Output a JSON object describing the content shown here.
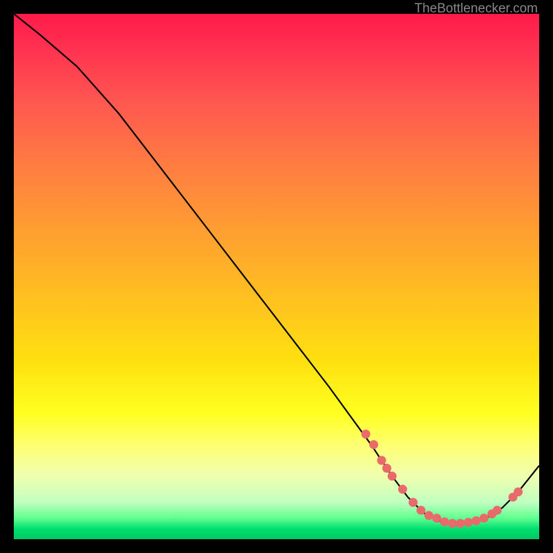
{
  "watermark": "TheBottlenecker.com",
  "chart_data": {
    "type": "line",
    "title": "",
    "xlabel": "",
    "ylabel": "",
    "xlim": [
      0,
      100
    ],
    "ylim": [
      0,
      100
    ],
    "gradient_note": "Background is vertical gradient: red (top, high bottleneck) through orange, yellow, to green (bottom, low bottleneck).",
    "curve": {
      "name": "bottleneck-curve",
      "x": [
        0,
        5,
        12,
        20,
        30,
        40,
        50,
        60,
        68,
        72,
        75,
        78,
        82,
        86,
        90,
        93,
        96,
        100
      ],
      "y": [
        100,
        96,
        90,
        81,
        68,
        55,
        42,
        29,
        18,
        12,
        8,
        5,
        3,
        3,
        4,
        6,
        9,
        14
      ]
    },
    "markers": {
      "name": "highlight-points",
      "color": "#e96a6a",
      "points": [
        {
          "x": 67,
          "y": 20
        },
        {
          "x": 68.5,
          "y": 18
        },
        {
          "x": 70,
          "y": 15
        },
        {
          "x": 71,
          "y": 13.5
        },
        {
          "x": 72,
          "y": 12
        },
        {
          "x": 74,
          "y": 9.5
        },
        {
          "x": 76,
          "y": 7
        },
        {
          "x": 77.5,
          "y": 5.5
        },
        {
          "x": 79,
          "y": 4.5
        },
        {
          "x": 80.5,
          "y": 4
        },
        {
          "x": 82,
          "y": 3.3
        },
        {
          "x": 83.5,
          "y": 3
        },
        {
          "x": 85,
          "y": 3
        },
        {
          "x": 86.5,
          "y": 3.2
        },
        {
          "x": 88,
          "y": 3.5
        },
        {
          "x": 89.5,
          "y": 4
        },
        {
          "x": 91,
          "y": 4.8
        },
        {
          "x": 92,
          "y": 5.5
        },
        {
          "x": 95,
          "y": 8
        },
        {
          "x": 96,
          "y": 9
        }
      ]
    }
  }
}
